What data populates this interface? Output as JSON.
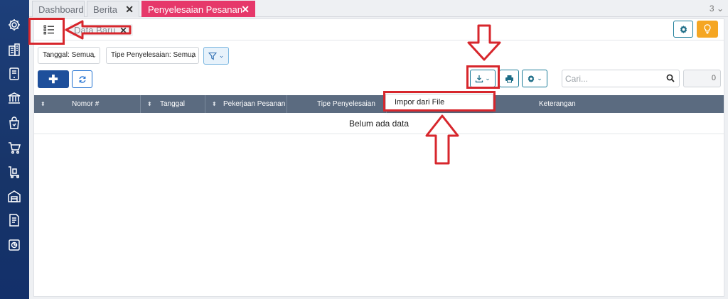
{
  "tabs": [
    {
      "label": "Dashboard"
    },
    {
      "label": "Berita"
    },
    {
      "label": "Penyelesaian Pesanan"
    }
  ],
  "tab_count": "3",
  "subtab": {
    "label": "Data Baru"
  },
  "filters": {
    "date": "Tanggal: Semua",
    "type": "Tipe Penyelesaian: Semua"
  },
  "search": {
    "placeholder": "Cari...",
    "count": "0"
  },
  "table": {
    "columns": [
      "Nomor #",
      "Tanggal",
      "Pekerjaan Pesanan",
      "Tipe Penyelesaian",
      "Keterangan"
    ],
    "empty_text": "Belum ada data"
  },
  "import_menu": {
    "item": "Impor dari File"
  },
  "colors": {
    "accent_tab": "#e6386a",
    "sidebar": "#1d3f7a",
    "primary": "#1e4f9b",
    "annotation": "#d7262c",
    "warning": "#f5a623"
  },
  "sidebar_icons": [
    "gear-icon",
    "building-icon",
    "tablet-icon",
    "bank-icon",
    "shopping-bag-icon",
    "cart-icon",
    "delivery-cart-icon",
    "warehouse-icon",
    "tax-document-icon",
    "report-icon"
  ]
}
